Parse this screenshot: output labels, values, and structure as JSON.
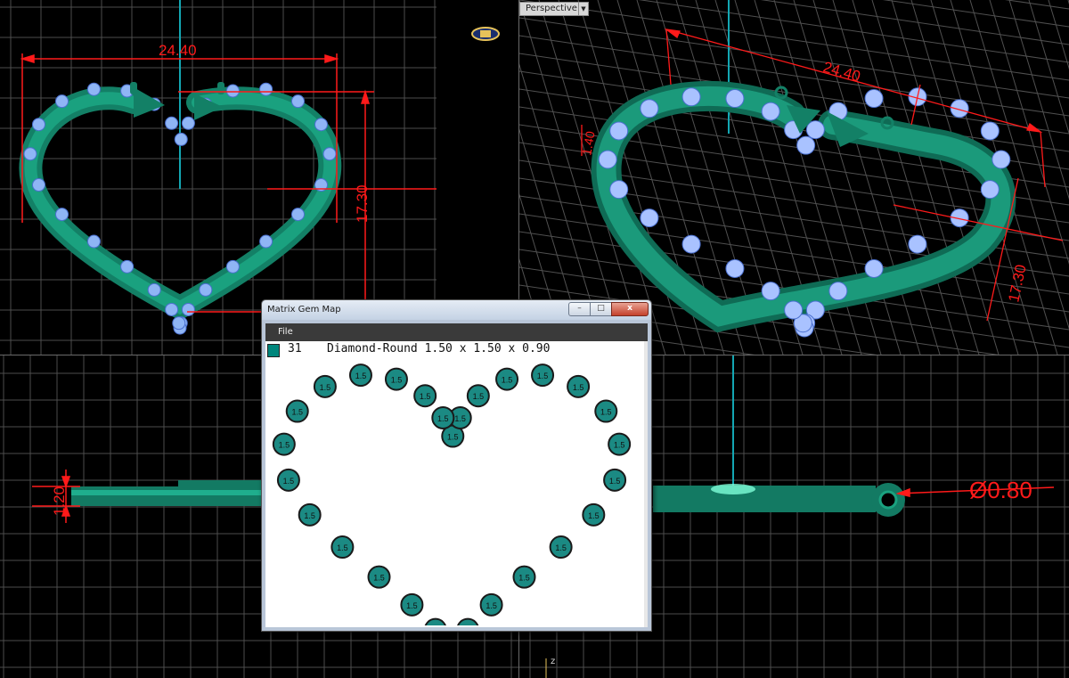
{
  "viewports": {
    "top_left": {
      "dimensions": {
        "width": "24.40",
        "height": "17.30"
      }
    },
    "top_right": {
      "label": "Perspective",
      "dimensions": {
        "width": "24.40",
        "height": "17.30",
        "thickness": "1.40"
      }
    },
    "bottom_left": {
      "dimensions": {
        "thickness": "1.20"
      }
    },
    "bottom_right": {
      "dimensions": {
        "diameter": "Ø0.80"
      },
      "axis_label": "z"
    }
  },
  "gem_map_window": {
    "title": "Matrix Gem Map",
    "menu": [
      "File"
    ],
    "controls": {
      "minimize": "–",
      "maximize": "□",
      "close": "x"
    },
    "summary": {
      "count": "31",
      "description": "Diamond-Round 1.50 x 1.50 x 0.90",
      "swatch_color": "#00867c"
    },
    "gem_label": "1.5",
    "gem_count": 31
  },
  "colors": {
    "model": "#14806a",
    "dimension": "#ff1a1a",
    "axis": "#13a7b3",
    "grid": "#5a5a5a",
    "gem": "#1b8a83"
  }
}
